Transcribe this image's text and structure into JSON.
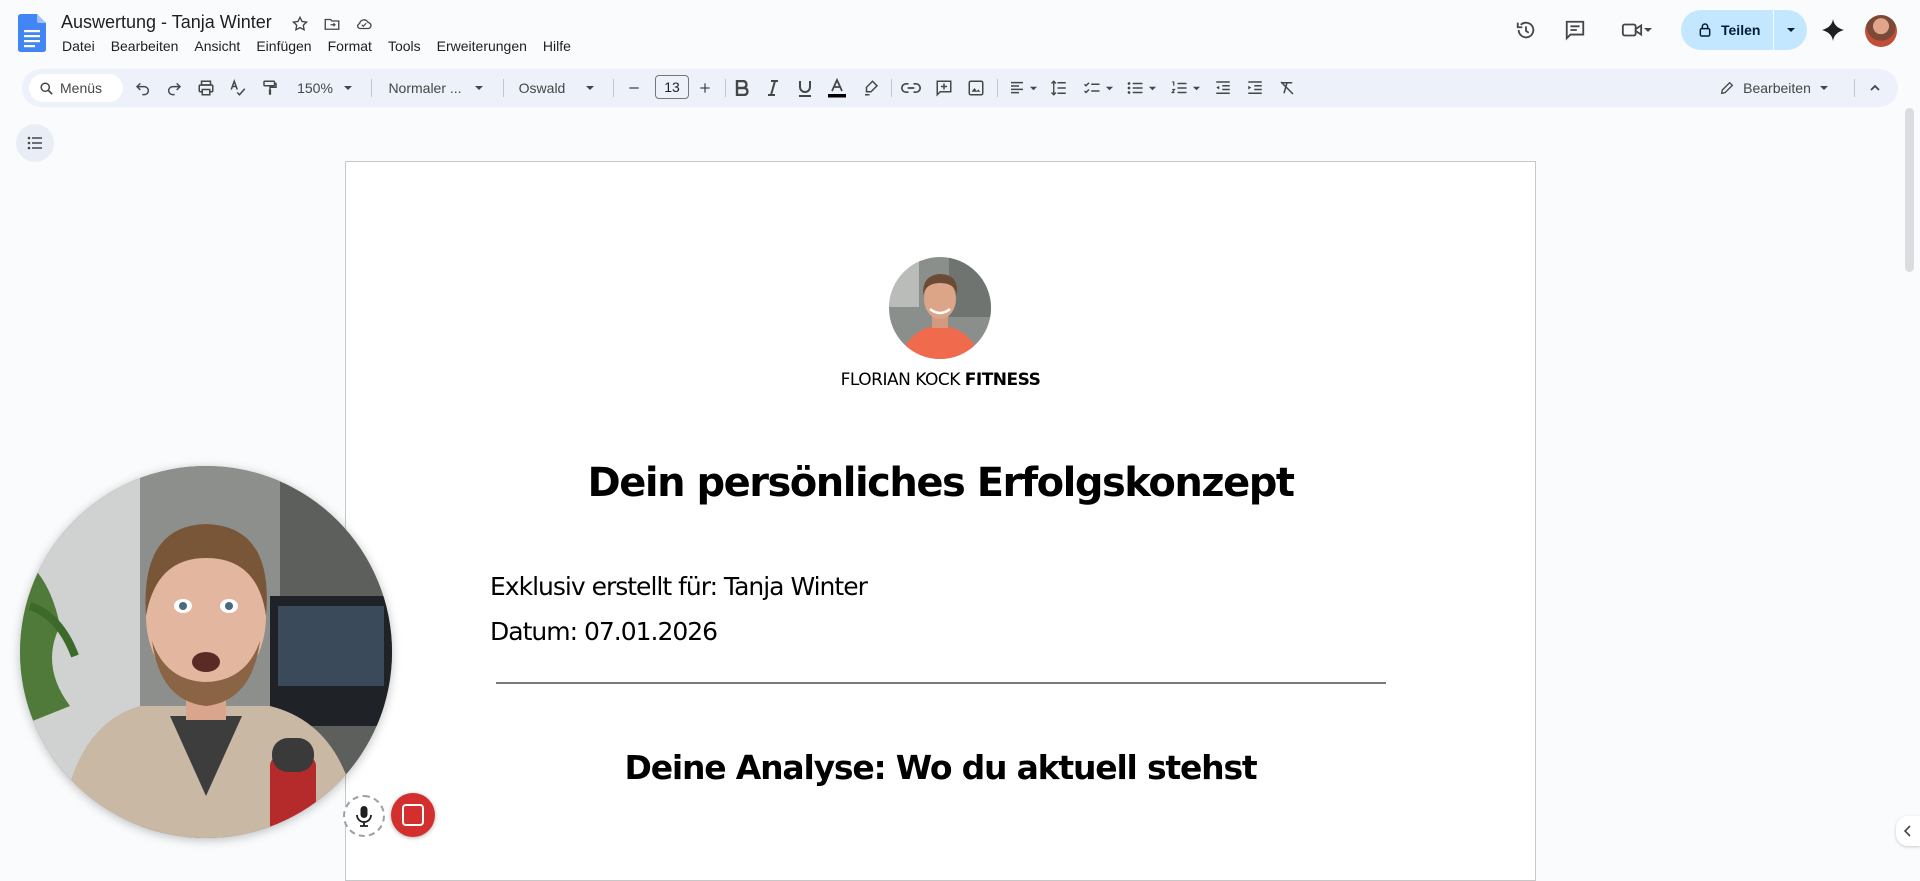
{
  "app": {
    "doc_title": "Auswertung - Tanja Winter",
    "menu": [
      "Datei",
      "Bearbeiten",
      "Ansicht",
      "Einfügen",
      "Format",
      "Tools",
      "Erweiterungen",
      "Hilfe"
    ],
    "share_label": "Teilen"
  },
  "toolbar": {
    "search_label": "Menüs",
    "zoom": "150%",
    "style": "Normaler ...",
    "font": "Oswald",
    "font_size": "13",
    "mode": "Bearbeiten"
  },
  "document": {
    "brand_regular": "FLORIAN KOCK",
    "brand_bold": "FITNESS",
    "heading": "Dein persönliches Erfolgskonzept",
    "created_for": "Exklusiv erstellt für: Tanja Winter",
    "date": "Datum: 07.01.2026",
    "section_heading": "Deine Analyse: Wo du aktuell stehst"
  },
  "colors": {
    "accent": "#c2e7ff",
    "toolbar_bg": "#edf2fa",
    "record_stop": "#d32f2f"
  }
}
